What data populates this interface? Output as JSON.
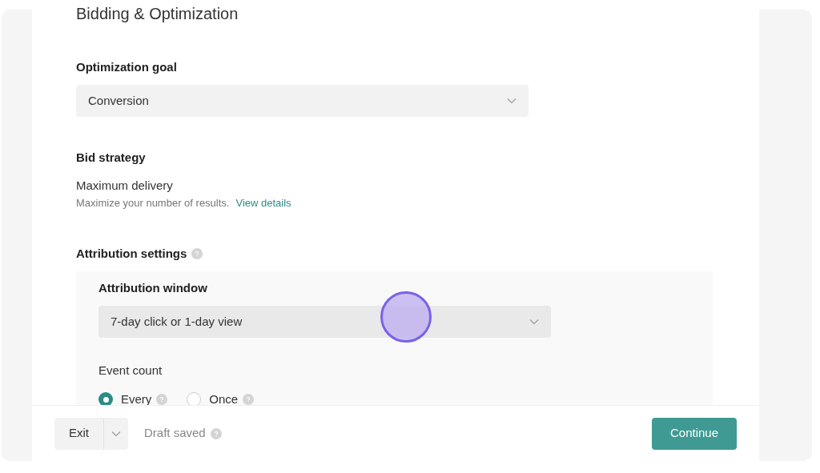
{
  "section_title": "Bidding & Optimization",
  "optimization_goal": {
    "label": "Optimization goal",
    "value": "Conversion"
  },
  "bid_strategy": {
    "label": "Bid strategy",
    "value": "Maximum delivery",
    "description": "Maximize your number of results.",
    "link": "View details"
  },
  "attribution_settings": {
    "label": "Attribution settings",
    "window_label": "Attribution window",
    "window_value": "7-day click or 1-day view",
    "event_count_label": "Event count",
    "event_count_options": [
      {
        "label": "Every",
        "selected": true
      },
      {
        "label": "Once",
        "selected": false
      }
    ]
  },
  "footer": {
    "exit": "Exit",
    "draft_status": "Draft saved",
    "continue": "Continue"
  }
}
